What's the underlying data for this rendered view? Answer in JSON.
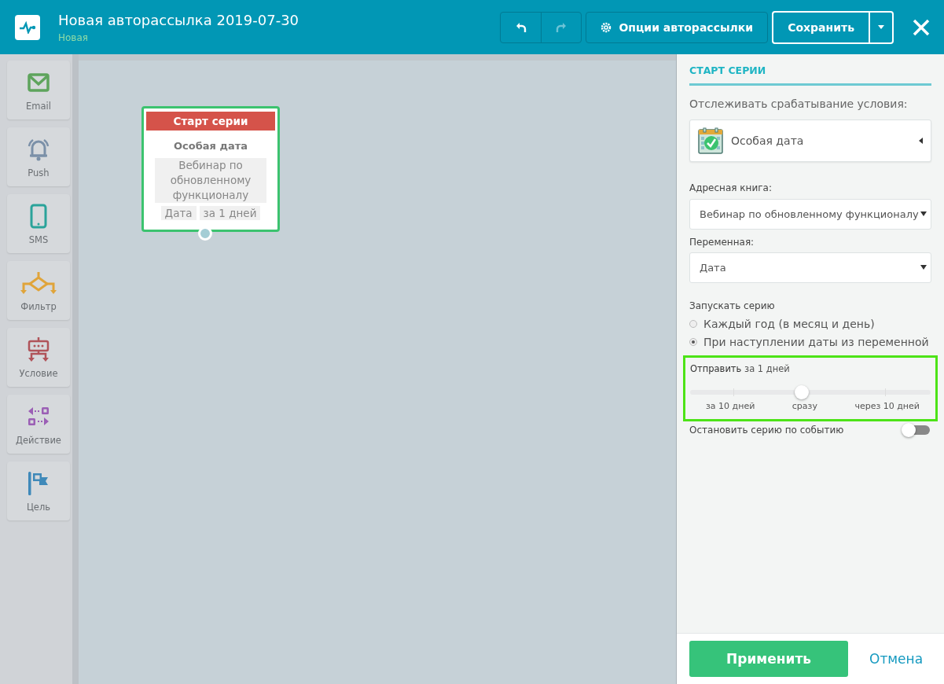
{
  "header": {
    "title": "Новая авторассылка 2019-07-30",
    "status": "Новая",
    "undo_disabled": false,
    "redo_disabled": true,
    "options_button": "Опции авторассылки",
    "save_button": "Сохранить"
  },
  "palette": [
    {
      "kind": "email",
      "label": "Email"
    },
    {
      "kind": "push",
      "label": "Push"
    },
    {
      "kind": "sms",
      "label": "SMS"
    },
    {
      "kind": "filter",
      "label": "Фильтр"
    },
    {
      "kind": "condition",
      "label": "Условие"
    },
    {
      "kind": "action",
      "label": "Действие"
    },
    {
      "kind": "goal",
      "label": "Цель"
    }
  ],
  "canvas": {
    "node": {
      "header": "Старт серии",
      "title": "Особая дата",
      "book": "Вебинар по обновленному функционалу",
      "tags": [
        "Дата",
        "за 1 дней"
      ],
      "selected": true
    }
  },
  "panel": {
    "heading": "СТАРТ СЕРИИ",
    "track_label": "Отслеживать срабатывание условия:",
    "trigger": "Особая дата",
    "book_label": "Адресная книга:",
    "book": "Вебинар по обновленному функционалу",
    "variable_label": "Переменная:",
    "variable": "Дата",
    "run_label": "Запускать серию",
    "run_options": [
      {
        "label": "Каждый год (в месяц и день)",
        "selected": false
      },
      {
        "label": "При наступлении даты из переменной",
        "selected": true
      }
    ],
    "send": {
      "text": "**Отправить** за 1 дней",
      "highlighted": true,
      "level": 0.465,
      "ticks": [
        "за 10 дней",
        "сразу",
        "через 10 дней"
      ]
    },
    "stop_label": "Остановить серию по событию",
    "stop_on": false,
    "apply_button": "Применить",
    "cancel_button": "Отмена"
  }
}
